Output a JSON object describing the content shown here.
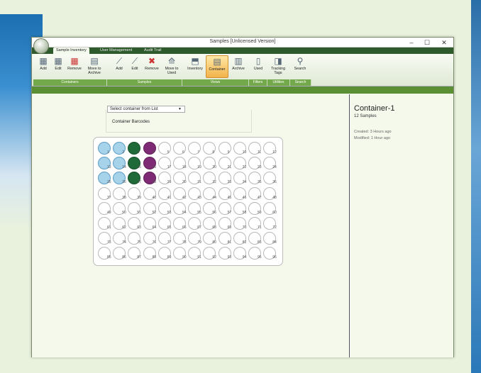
{
  "window": {
    "title": "Samples [Unlicensed Version]",
    "minimize": "–",
    "maximize": "☐",
    "close": "✕"
  },
  "tabs": [
    "Sample Inventory",
    "User Management",
    "Audit Trail"
  ],
  "ribbon": {
    "buttons": [
      {
        "label": "Add",
        "icon": "grid-add-icon"
      },
      {
        "label": "Edit",
        "icon": "grid-edit-icon"
      },
      {
        "label": "Remove",
        "icon": "grid-remove-icon"
      },
      {
        "label": "Move to Archive",
        "icon": "grid-archive-icon"
      },
      {
        "label": "Add",
        "icon": "tube-add-icon"
      },
      {
        "label": "Edit",
        "icon": "tube-edit-icon"
      },
      {
        "label": "Remove",
        "icon": "tube-remove-icon"
      },
      {
        "label": "Move to Used",
        "icon": "tube-used-icon"
      },
      {
        "label": "Inventory",
        "icon": "inventory-icon"
      },
      {
        "label": "Container",
        "icon": "container-icon"
      },
      {
        "label": "Archive",
        "icon": "archive-icon"
      },
      {
        "label": "Used",
        "icon": "used-filter-icon"
      },
      {
        "label": "Tracking Tags",
        "icon": "tag-icon"
      },
      {
        "label": "Search",
        "icon": "search-icon"
      }
    ],
    "groups": [
      "Containers",
      "Samples",
      "Views",
      "Filters",
      "Utilities",
      "Search"
    ]
  },
  "container_panel": {
    "select_label": "Select container from List",
    "barcodes_label": "Container Barcodes"
  },
  "plate": {
    "wells": [
      {
        "n": "1",
        "c": "blue"
      },
      {
        "n": "2",
        "c": "blue"
      },
      {
        "n": "3",
        "c": "green"
      },
      {
        "n": "4",
        "c": "purple"
      },
      {
        "n": "5",
        "c": "empty"
      },
      {
        "n": "6",
        "c": "empty"
      },
      {
        "n": "7",
        "c": "empty"
      },
      {
        "n": "8",
        "c": "empty"
      },
      {
        "n": "9",
        "c": "empty"
      },
      {
        "n": "10",
        "c": "empty"
      },
      {
        "n": "11",
        "c": "empty"
      },
      {
        "n": "12",
        "c": "empty"
      },
      {
        "n": "13",
        "c": "blue"
      },
      {
        "n": "14",
        "c": "blue"
      },
      {
        "n": "15",
        "c": "green"
      },
      {
        "n": "16",
        "c": "purple"
      },
      {
        "n": "17",
        "c": "empty"
      },
      {
        "n": "18",
        "c": "empty"
      },
      {
        "n": "19",
        "c": "empty"
      },
      {
        "n": "20",
        "c": "empty"
      },
      {
        "n": "21",
        "c": "empty"
      },
      {
        "n": "22",
        "c": "empty"
      },
      {
        "n": "23",
        "c": "empty"
      },
      {
        "n": "24",
        "c": "empty"
      },
      {
        "n": "25",
        "c": "blue"
      },
      {
        "n": "26",
        "c": "blue"
      },
      {
        "n": "27",
        "c": "green"
      },
      {
        "n": "28",
        "c": "purple"
      },
      {
        "n": "29",
        "c": "empty"
      },
      {
        "n": "30",
        "c": "empty"
      },
      {
        "n": "31",
        "c": "empty"
      },
      {
        "n": "32",
        "c": "empty"
      },
      {
        "n": "33",
        "c": "empty"
      },
      {
        "n": "34",
        "c": "empty"
      },
      {
        "n": "35",
        "c": "empty"
      },
      {
        "n": "36",
        "c": "empty"
      },
      {
        "n": "37",
        "c": "empty"
      },
      {
        "n": "38",
        "c": "empty"
      },
      {
        "n": "39",
        "c": "empty"
      },
      {
        "n": "40",
        "c": "empty"
      },
      {
        "n": "41",
        "c": "empty"
      },
      {
        "n": "42",
        "c": "empty"
      },
      {
        "n": "43",
        "c": "empty"
      },
      {
        "n": "44",
        "c": "empty"
      },
      {
        "n": "45",
        "c": "empty"
      },
      {
        "n": "46",
        "c": "empty"
      },
      {
        "n": "47",
        "c": "empty"
      },
      {
        "n": "48",
        "c": "empty"
      },
      {
        "n": "49",
        "c": "empty"
      },
      {
        "n": "50",
        "c": "empty"
      },
      {
        "n": "51",
        "c": "empty"
      },
      {
        "n": "52",
        "c": "empty"
      },
      {
        "n": "53",
        "c": "empty"
      },
      {
        "n": "54",
        "c": "empty"
      },
      {
        "n": "55",
        "c": "empty"
      },
      {
        "n": "56",
        "c": "empty"
      },
      {
        "n": "57",
        "c": "empty"
      },
      {
        "n": "58",
        "c": "empty"
      },
      {
        "n": "59",
        "c": "empty"
      },
      {
        "n": "60",
        "c": "empty"
      },
      {
        "n": "61",
        "c": "empty"
      },
      {
        "n": "62",
        "c": "empty"
      },
      {
        "n": "63",
        "c": "empty"
      },
      {
        "n": "64",
        "c": "empty"
      },
      {
        "n": "65",
        "c": "empty"
      },
      {
        "n": "66",
        "c": "empty"
      },
      {
        "n": "67",
        "c": "empty"
      },
      {
        "n": "68",
        "c": "empty"
      },
      {
        "n": "69",
        "c": "empty"
      },
      {
        "n": "70",
        "c": "empty"
      },
      {
        "n": "71",
        "c": "empty"
      },
      {
        "n": "72",
        "c": "empty"
      },
      {
        "n": "73",
        "c": "empty"
      },
      {
        "n": "74",
        "c": "empty"
      },
      {
        "n": "75",
        "c": "empty"
      },
      {
        "n": "76",
        "c": "empty"
      },
      {
        "n": "77",
        "c": "empty"
      },
      {
        "n": "78",
        "c": "empty"
      },
      {
        "n": "79",
        "c": "empty"
      },
      {
        "n": "80",
        "c": "empty"
      },
      {
        "n": "81",
        "c": "empty"
      },
      {
        "n": "82",
        "c": "empty"
      },
      {
        "n": "83",
        "c": "empty"
      },
      {
        "n": "84",
        "c": "empty"
      },
      {
        "n": "85",
        "c": "empty"
      },
      {
        "n": "86",
        "c": "empty"
      },
      {
        "n": "87",
        "c": "empty"
      },
      {
        "n": "88",
        "c": "empty"
      },
      {
        "n": "89",
        "c": "empty"
      },
      {
        "n": "90",
        "c": "empty"
      },
      {
        "n": "91",
        "c": "empty"
      },
      {
        "n": "92",
        "c": "empty"
      },
      {
        "n": "93",
        "c": "empty"
      },
      {
        "n": "94",
        "c": "empty"
      },
      {
        "n": "95",
        "c": "empty"
      },
      {
        "n": "96",
        "c": "empty"
      }
    ]
  },
  "details": {
    "title": "Container-1",
    "count": "12 Samples",
    "created": "Created: 3 Hours ago",
    "modified": "Modified: 1 Hour ago"
  },
  "colors": {
    "blue": "#a6d2ea",
    "green": "#1f6a38",
    "purple": "#7e2a74",
    "ribbon_group": "#73a94a",
    "tabbar": "#2e5a2c"
  }
}
